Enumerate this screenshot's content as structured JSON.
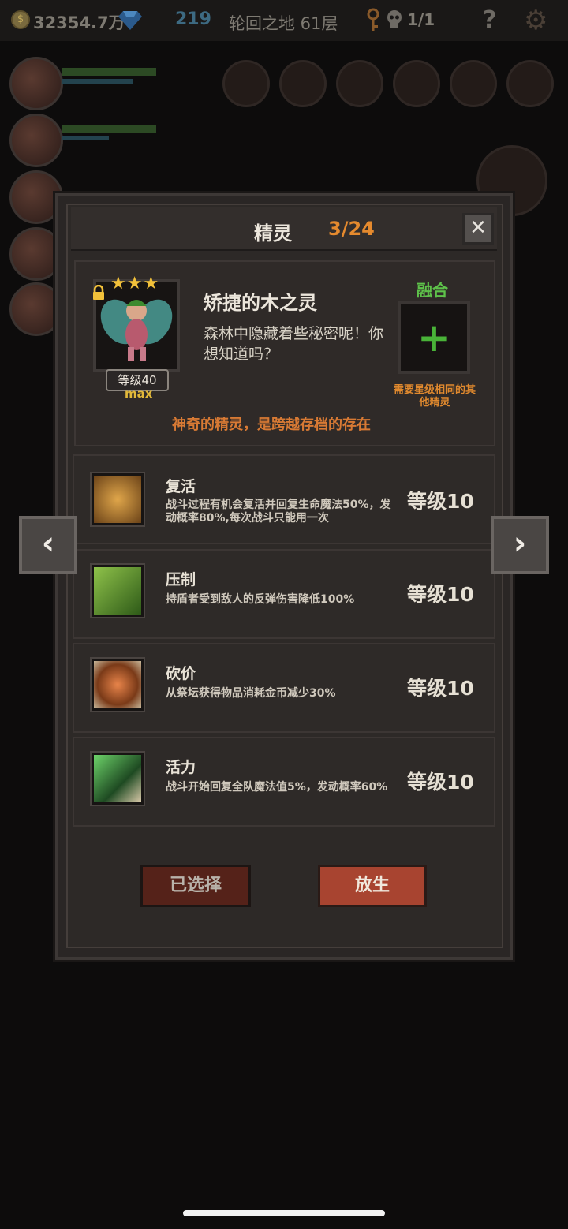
{
  "topbar": {
    "coin_symbol": "$",
    "gold": "32354.7万",
    "gems": "219",
    "floor": "轮回之地 61层",
    "boss_count": "1/1",
    "help_symbol": "?",
    "settings_symbol": "⚙"
  },
  "modal": {
    "title": "精灵",
    "count": "3/24",
    "close_symbol": "✕"
  },
  "spirit": {
    "stars": "★★★",
    "level": "等级40",
    "max": "max",
    "name": "矫捷的木之灵",
    "desc": "森林中隐藏着些秘密呢！你想知道吗？",
    "tagline": "神奇的精灵，是跨越存档的存在"
  },
  "fuse": {
    "title": "融合",
    "plus": "+",
    "note": "需要星级相同的其他精灵"
  },
  "skills": [
    {
      "name": "复活",
      "desc": "战斗过程有机会复活并回复生命魔法50%，发动概率80%,每次战斗只能用一次",
      "level": "等级10"
    },
    {
      "name": "压制",
      "desc": "持盾者受到敌人的反弹伤害降低100%",
      "level": "等级10"
    },
    {
      "name": "砍价",
      "desc": "从祭坛获得物品消耗金币减少30%",
      "level": "等级10"
    },
    {
      "name": "活力",
      "desc": "战斗开始回复全队魔法值5%，发动概率60%",
      "level": "等级10"
    }
  ],
  "buttons": {
    "selected": "已选择",
    "release": "放生"
  },
  "nav": {
    "prev": "‹",
    "next": "›"
  },
  "colors": {
    "accent_orange": "#e58a2e",
    "fuse_green": "#5ec24a",
    "star_gold": "#f2c13a",
    "release_red": "#a84430"
  }
}
